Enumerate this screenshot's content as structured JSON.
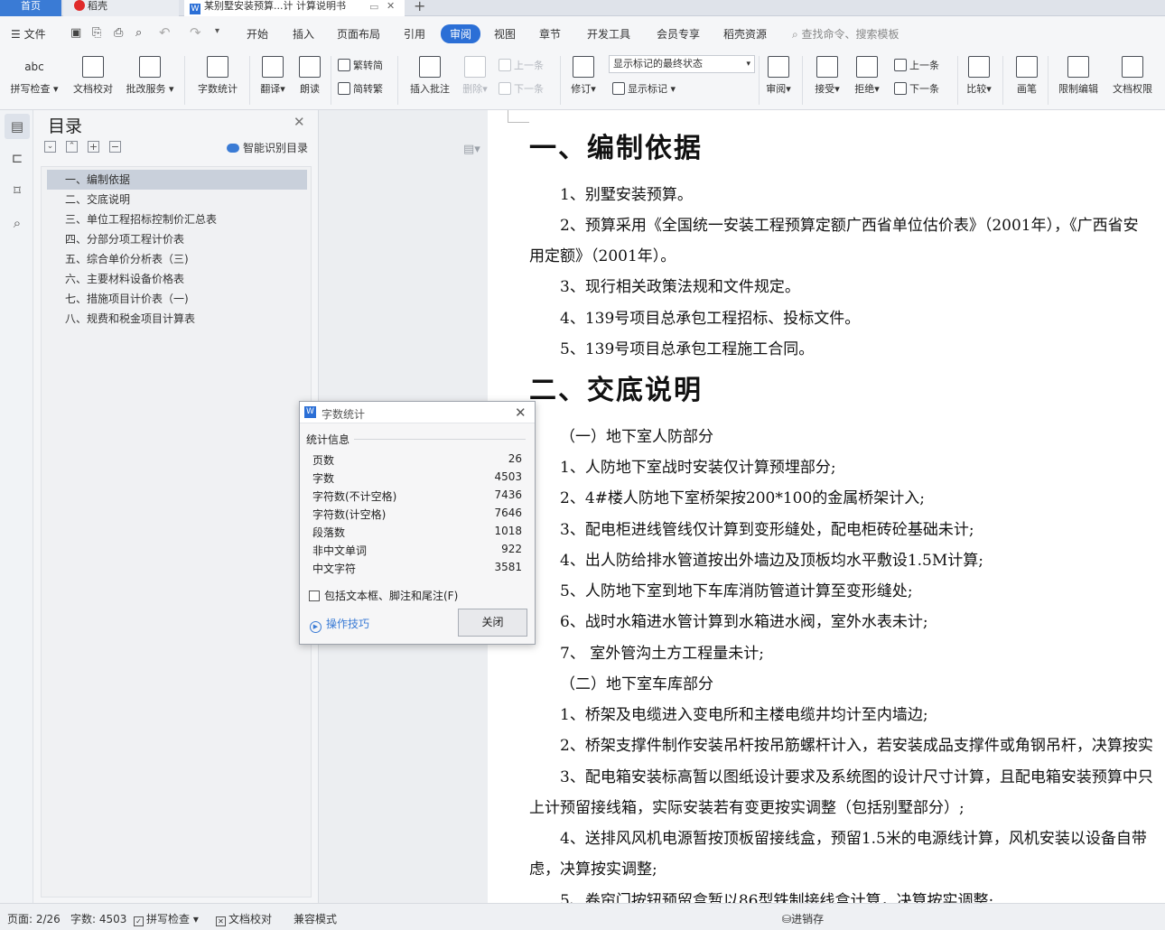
{
  "tabs": [
    {
      "label": "首页"
    },
    {
      "label": "稻壳"
    },
    {
      "label": "某别墅安装预算...计 计算说明书"
    }
  ],
  "menu": {
    "file": "文件",
    "items": [
      "开始",
      "插入",
      "页面布局",
      "引用",
      "审阅",
      "视图",
      "章节",
      "开发工具",
      "会员专享",
      "稻壳资源"
    ],
    "active": "审阅",
    "search_placeholder": "查找命令、搜索模板"
  },
  "ribbon": {
    "spell": "拼写检查",
    "proof": "文档校对",
    "revise_service": "批改服务",
    "word_count": "字数统计",
    "translate": "翻译",
    "read_aloud": "朗读",
    "trad_to_simp": "繁转简",
    "simp_to_trad": "简转繁",
    "insert_comment": "插入批注",
    "delete": "删除",
    "prev_comment": "上一条",
    "next_comment": "下一条",
    "track": "修订",
    "markup_select": "显示标记的最终状态",
    "show_markup": "显示标记",
    "review": "审阅",
    "accept": "接受",
    "reject": "拒绝",
    "prev_change": "上一条",
    "next_change": "下一条",
    "compare": "比较",
    "ink": "画笔",
    "restrict": "限制编辑",
    "permission": "文档权限"
  },
  "nav": {
    "title": "目录",
    "smart_toc": "智能识别目录",
    "items": [
      {
        "label": "一、编制依据"
      },
      {
        "label": "二、交底说明"
      },
      {
        "label": "三、单位工程招标控制价汇总表"
      },
      {
        "label": "四、分部分项工程计价表"
      },
      {
        "label": "五、综合单价分析表（三)"
      },
      {
        "label": "六、主要材料设备价格表"
      },
      {
        "label": "七、措施项目计价表（一)"
      },
      {
        "label": "八、规费和税金项目计算表"
      }
    ]
  },
  "document": {
    "h1a": "一、编制依据",
    "p1": "1、别墅安装预算。",
    "p2a": "2、预算采用《全国统一安装工程预算定额广西省单位估价表》（2001年），《广西省安",
    "p2b": "用定额》（2001年）。",
    "p3": "3、现行相关政策法规和文件规定。",
    "p4": "4、139号项目总承包工程招标、投标文件。",
    "p5": "5、139号项目总承包工程施工合同。",
    "h1b": "二、交底说明",
    "s1": "（一）地下室人防部分",
    "a1": "1、人防地下室战时安装仅计算预埋部分;",
    "a2": "2、4#楼人防地下室桥架按200*100的金属桥架计入;",
    "a3": "3、配电柜进线管线仅计算到变形缝处，配电柜砖砼基础未计;",
    "a4": "4、出人防给排水管道按出外墙边及顶板均水平敷设1.5M计算;",
    "a5": "5、人防地下室到地下车库消防管道计算至变形缝处;",
    "a6": "6、战时水箱进水管计算到水箱进水阀，室外水表未计;",
    "a7": "7、 室外管沟土方工程量未计;",
    "s2": "（二）地下室车库部分",
    "b1": "1、桥架及电缆进入变电所和主楼电缆井均计至内墙边;",
    "b2": "2、桥架支撑件制作安装吊杆按吊筋螺杆计入，若安装成品支撑件或角钢吊杆，决算按实",
    "b3a": "3、配电箱安装标高暂以图纸设计要求及系统图的设计尺寸计算，且配电箱安装预算中只",
    "b3b": "上计预留接线箱，实际安装若有变更按实调整（包括别墅部分）;",
    "b4a": "4、送排风风机电源暂按顶板留接线盒，预留1.5米的电源线计算，风机安装以设备自带",
    "b4b": "虑，决算按实调整;",
    "b5": "5、卷帘门按钮预留盒暂以86型铁制接线盒计算，决算按实调整;"
  },
  "dialog": {
    "title": "字数统计",
    "section": "统计信息",
    "rows": [
      {
        "label": "页数",
        "value": "26"
      },
      {
        "label": "字数",
        "value": "4503"
      },
      {
        "label": "字符数(不计空格)",
        "value": "7436"
      },
      {
        "label": "字符数(计空格)",
        "value": "7646"
      },
      {
        "label": "段落数",
        "value": "1018"
      },
      {
        "label": "非中文单词",
        "value": "922"
      },
      {
        "label": "中文字符",
        "value": "3581"
      }
    ],
    "checkbox_label": "包括文本框、脚注和尾注(F)",
    "tips": "操作技巧",
    "close": "关闭"
  },
  "status": {
    "page": "页面: 2/26",
    "words": "字数: 4503",
    "spell": "拼写检查",
    "proof": "文档校对",
    "compat": "兼容模式",
    "jxc": "进销存"
  },
  "colors": {
    "accent": "#2b6fd6",
    "nav_selected": "#c9d0db"
  }
}
